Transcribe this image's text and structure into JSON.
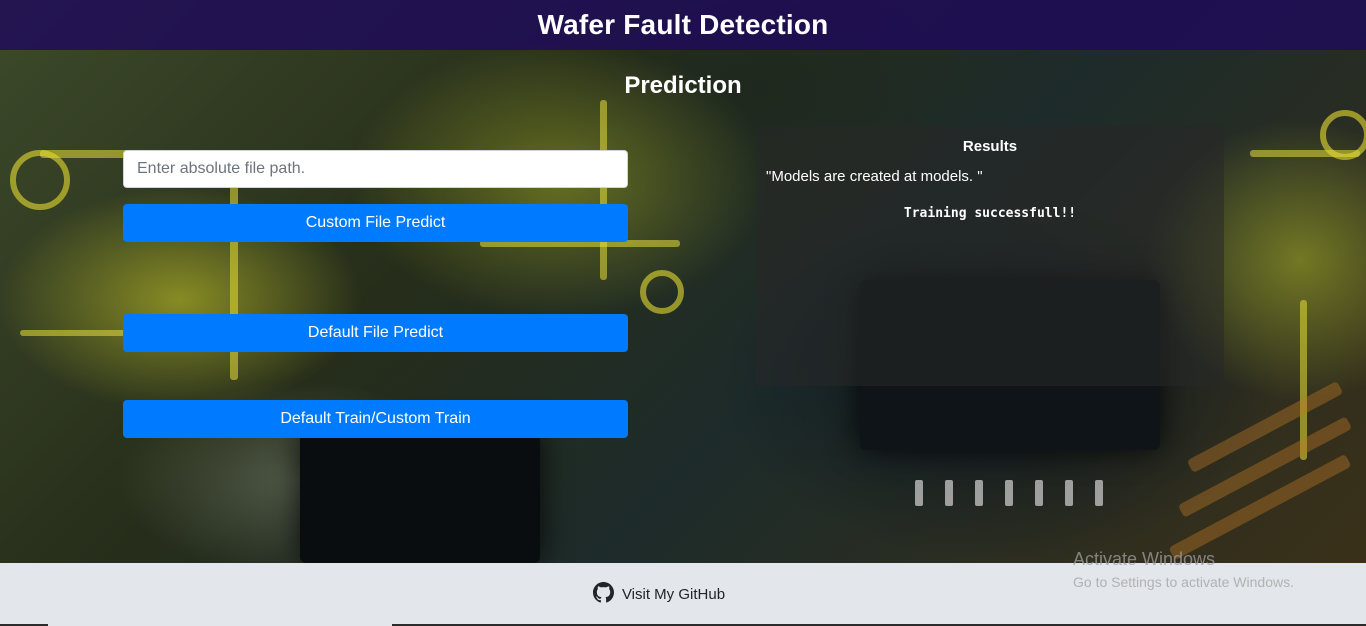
{
  "header": {
    "title": "Wafer Fault Detection"
  },
  "main": {
    "subtitle": "Prediction",
    "file_path_input": {
      "value": "",
      "placeholder": "Enter absolute file path."
    },
    "buttons": {
      "custom_predict": "Custom File Predict",
      "default_predict": "Default File Predict",
      "train": "Default Train/Custom Train"
    }
  },
  "results": {
    "title": "Results",
    "message": "\"Models are created at models. \"",
    "log": "Training successfull!!"
  },
  "footer": {
    "github_link": "Visit My GitHub",
    "icon": "github-icon"
  },
  "watermark": {
    "line1": "Activate Windows",
    "line2": "Go to Settings to activate Windows."
  },
  "colors": {
    "header_bg": "#1e0a5a",
    "button": "#007bff",
    "footer_bg": "#e3e6ea"
  }
}
